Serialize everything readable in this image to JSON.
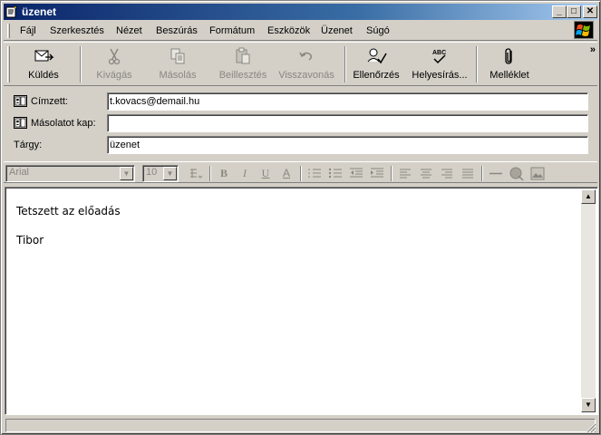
{
  "window": {
    "title": "üzenet",
    "minimize": "_",
    "maximize": "□",
    "close": "✕"
  },
  "menu": [
    "Fájl",
    "Szerkesztés",
    "Nézet",
    "Beszúrás",
    "Formátum",
    "Eszközök",
    "Üzenet",
    "Súgó"
  ],
  "toolbar": {
    "send": "Küldés",
    "cut": "Kivágás",
    "copy": "Másolás",
    "paste": "Beillesztés",
    "undo": "Visszavonás",
    "check": "Ellenőrzés",
    "spelling": "Helyesírás...",
    "spelling_icon_text": "ABC",
    "attach": "Melléklet",
    "more": "»"
  },
  "fields": {
    "to_label": "Címzett:",
    "to_value": "t.kovacs@demail.hu",
    "cc_label": "Másolatot kap:",
    "cc_value": "",
    "subject_label": "Tárgy:",
    "subject_value": "üzenet"
  },
  "format": {
    "font": "Arial",
    "size": "10",
    "bold": "B",
    "italic": "I",
    "underline": "U",
    "font_color": "A"
  },
  "body": {
    "line1": "Tetszett az előadás",
    "line2": "Tibor"
  },
  "colors": {
    "titlebar_start": "#0a246a",
    "titlebar_end": "#a6caf0",
    "chrome": "#d4d0c8"
  }
}
